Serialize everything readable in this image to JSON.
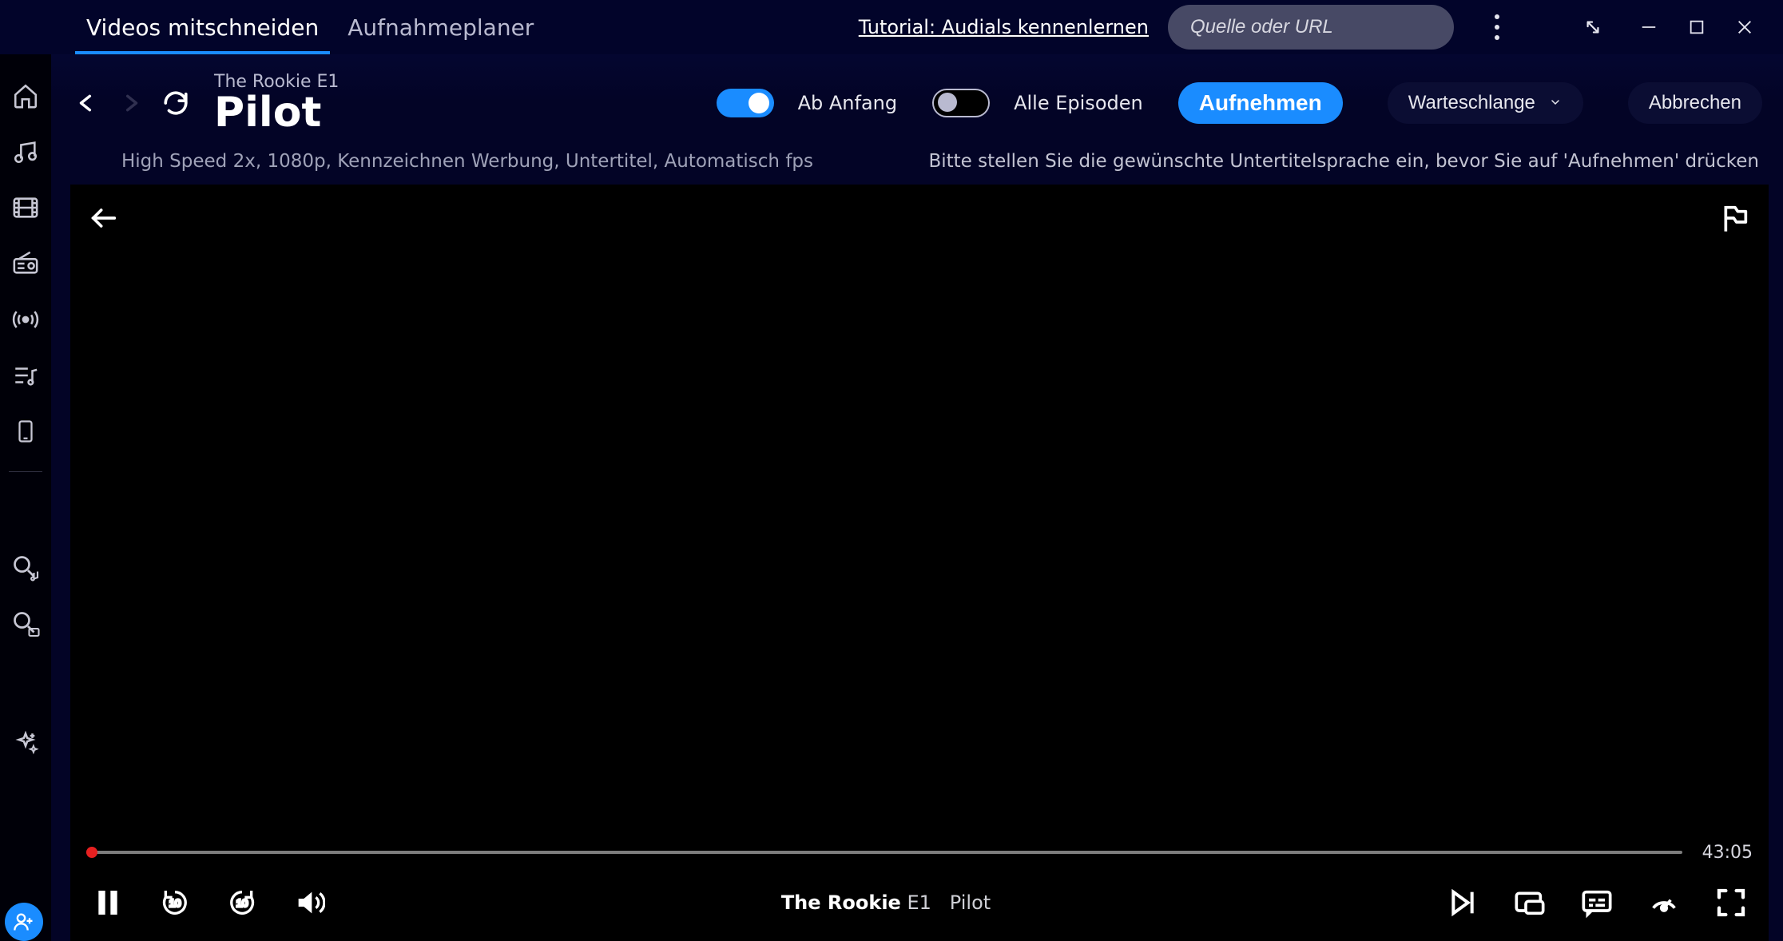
{
  "topbar": {
    "tabs": [
      {
        "label": "Videos mitschneiden",
        "active": true
      },
      {
        "label": "Aufnahmeplaner",
        "active": false
      }
    ],
    "tutorial_link": "Tutorial: Audials kennenlernen",
    "search_placeholder": "Quelle oder URL"
  },
  "header": {
    "eyebrow": "The Rookie E1",
    "title": "Pilot",
    "toggle_begin_label": "Ab Anfang",
    "toggle_episodes_label": "Alle Episoden",
    "record_button": "Aufnehmen",
    "queue_button": "Warteschlange",
    "cancel_button": "Abbrechen"
  },
  "subline": {
    "settings": "High Speed 2x, 1080p, Kennzeichnen Werbung, Untertitel, Automatisch fps",
    "hint": "Bitte stellen Sie die gewünschte Untertitelsprache ein, bevor Sie auf 'Aufnehmen' drücken"
  },
  "player": {
    "total_time": "43:05",
    "now_playing_show": "The Rookie",
    "now_playing_episode": "E1",
    "now_playing_title": "Pilot",
    "skip_seconds": "10"
  },
  "colors": {
    "accent": "#1a8cff",
    "background": "#02042a",
    "scrub_thumb": "#e72020"
  },
  "sidebar": {
    "items": [
      "home",
      "music",
      "video",
      "radio",
      "podcast",
      "playlist",
      "mobile",
      "music-search",
      "video-search",
      "ai-enhance"
    ]
  }
}
